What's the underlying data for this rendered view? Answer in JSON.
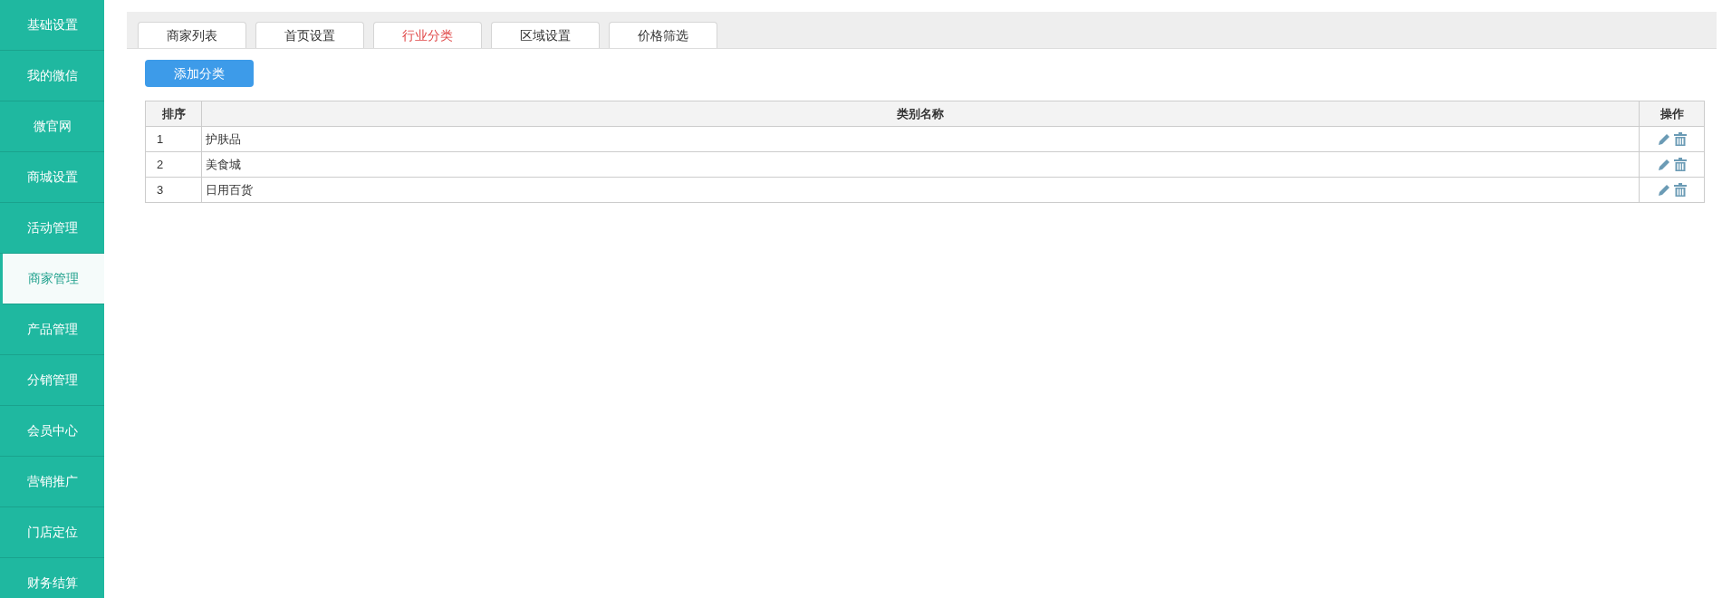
{
  "sidebar": {
    "items": [
      {
        "label": "基础设置",
        "selected": false
      },
      {
        "label": "我的微信",
        "selected": false
      },
      {
        "label": "微官网",
        "selected": false
      },
      {
        "label": "商城设置",
        "selected": false
      },
      {
        "label": "活动管理",
        "selected": false
      },
      {
        "label": "商家管理",
        "selected": true
      },
      {
        "label": "产品管理",
        "selected": false
      },
      {
        "label": "分销管理",
        "selected": false
      },
      {
        "label": "会员中心",
        "selected": false
      },
      {
        "label": "营销推广",
        "selected": false
      },
      {
        "label": "门店定位",
        "selected": false
      },
      {
        "label": "财务结算",
        "selected": false
      }
    ]
  },
  "tabs": [
    {
      "label": "商家列表",
      "selected": false
    },
    {
      "label": "首页设置",
      "selected": false
    },
    {
      "label": "行业分类",
      "selected": true
    },
    {
      "label": "区域设置",
      "selected": false
    },
    {
      "label": "价格筛选",
      "selected": false
    }
  ],
  "add_button": "添加分类",
  "table": {
    "columns": [
      "排序",
      "类别名称",
      "操作"
    ],
    "rows": [
      {
        "order": "1",
        "name": "护肤品"
      },
      {
        "order": "2",
        "name": "美食城"
      },
      {
        "order": "3",
        "name": "日用百货"
      }
    ]
  }
}
